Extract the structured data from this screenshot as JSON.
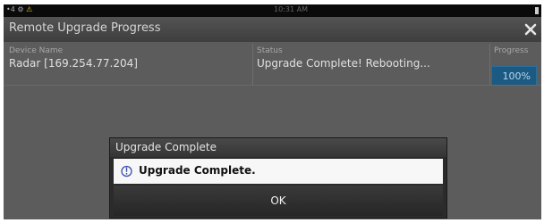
{
  "statusbar": {
    "left_text": "•4 ⚙",
    "warning_glyph": "⚠",
    "center_text": "10:31 AM"
  },
  "window": {
    "title": "Remote Upgrade Progress"
  },
  "table": {
    "headers": {
      "device": "Device Name",
      "status": "Status",
      "progress": "Progress"
    },
    "rows": [
      {
        "device": "Radar [169.254.77.204]",
        "status": "Upgrade Complete! Rebooting...",
        "progress": "100%",
        "progress_fraction": 1.0
      }
    ]
  },
  "dialog": {
    "title": "Upgrade Complete",
    "message": "Upgrade Complete.",
    "ok_label": "OK",
    "icon": "info-icon"
  },
  "colors": {
    "accent": "#1b5a82",
    "background": "#5c5c5c"
  }
}
